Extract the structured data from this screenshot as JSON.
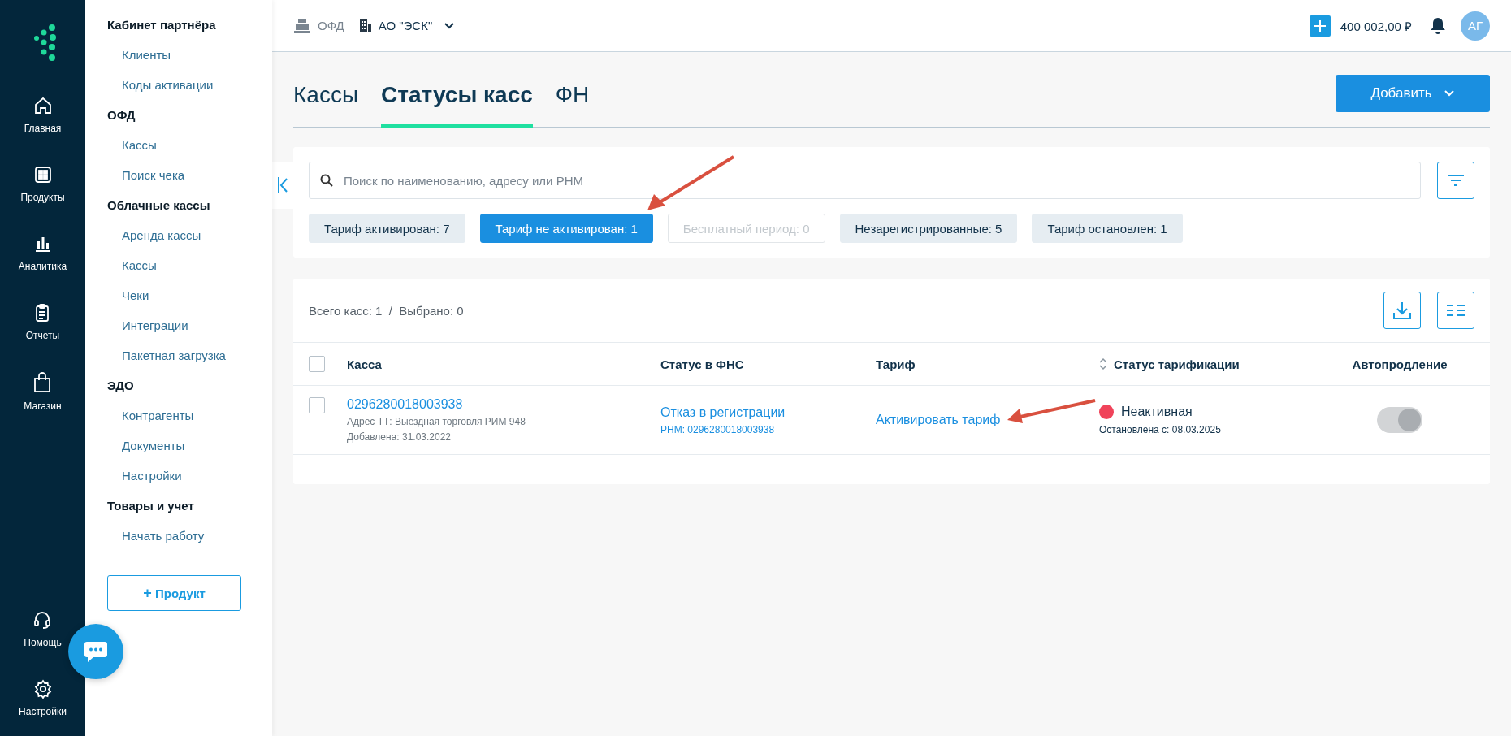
{
  "nav_rail": {
    "items": [
      {
        "label": "Главная"
      },
      {
        "label": "Продукты"
      },
      {
        "label": "Аналитика"
      },
      {
        "label": "Отчеты"
      },
      {
        "label": "Магазин"
      }
    ],
    "bottom_items": [
      {
        "label": "Помощь"
      },
      {
        "label": "Настройки"
      }
    ]
  },
  "sidebar": {
    "sections": [
      {
        "title": "Кабинет партнёра",
        "items": [
          "Клиенты",
          "Коды активации"
        ]
      },
      {
        "title": "ОФД",
        "items": [
          "Кассы",
          "Поиск чека"
        ]
      },
      {
        "title": "Облачные кассы",
        "items": [
          "Аренда кассы",
          "Кассы",
          "Чеки",
          "Интеграции",
          "Пакетная загрузка"
        ]
      },
      {
        "title": "ЭДО",
        "items": [
          "Контрагенты",
          "Документы",
          "Настройки"
        ]
      },
      {
        "title": "Товары и учет",
        "items": [
          "Начать работу"
        ]
      }
    ],
    "product_button": {
      "icon": "+",
      "label": "Продукт"
    }
  },
  "top_bar": {
    "service": "ОФД",
    "organization": "АО \"ЭСК\"",
    "balance": "400 002,00 ₽",
    "avatar": "АГ"
  },
  "tabs": [
    {
      "label": "Кассы",
      "selected": false
    },
    {
      "label": "Статусы касс",
      "selected": true
    },
    {
      "label": "ФН",
      "selected": false
    }
  ],
  "add_button": "Добавить",
  "search": {
    "placeholder": "Поиск по наименованию, адресу или РНМ"
  },
  "filter_chips": [
    {
      "label": "Тариф активирован: 7",
      "selected": false,
      "disabled": false
    },
    {
      "label": "Тариф не активирован: 1",
      "selected": true,
      "disabled": false
    },
    {
      "label": "Бесплатный период: 0",
      "selected": false,
      "disabled": true
    },
    {
      "label": "Незарегистрированные: 5",
      "selected": false,
      "disabled": false
    },
    {
      "label": "Тариф остановлен: 1",
      "selected": false,
      "disabled": false
    }
  ],
  "table": {
    "summary": "Всего касс: 1  /  Выбрано: 0",
    "select_all_checked": false,
    "columns": [
      "Касса",
      "Статус в ФНС",
      "Тариф",
      "Статус тарификации",
      "Автопродление"
    ],
    "rows": [
      {
        "checked": false,
        "number": "0296280018003938",
        "address": "Адрес ТТ: Выездная торговля РИМ 948",
        "added": "Добавлена: 31.03.2022",
        "fns_status": "Отказ в регистрации",
        "rnm": "РНМ: 0296280018003938",
        "tariff": "Активировать тариф",
        "billing_status": "Неактивная",
        "color": "#f0435a",
        "stopped": "Остановлена с: 08.03.2025",
        "autorenew": {
          "on": true,
          "disabled": true
        }
      }
    ]
  }
}
